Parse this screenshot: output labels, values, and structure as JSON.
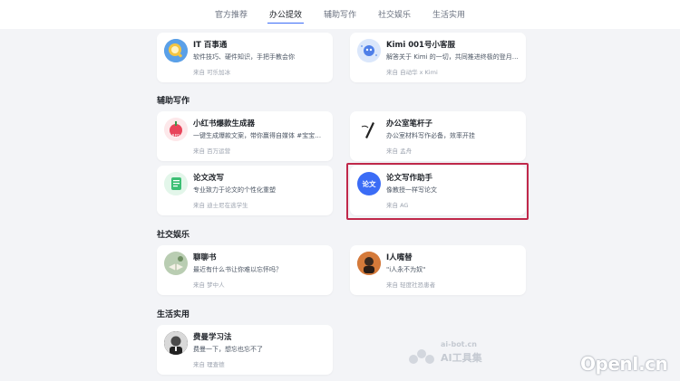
{
  "tabs": [
    "官方推荐",
    "办公提效",
    "辅助写作",
    "社交娱乐",
    "生活实用"
  ],
  "active_tab": "办公提效",
  "sections": {
    "writing": "辅助写作",
    "social": "社交娱乐",
    "life": "生活实用"
  },
  "cards": {
    "it": {
      "title": "IT 百事通",
      "desc": "软件技巧、硬件知识，手把手教会你",
      "author": "来自 可乐加冰"
    },
    "kimi": {
      "title": "Kimi 001号小客服",
      "desc": "解答关于 Kimi 的一切，共同推进终极的登月计划",
      "author": "来自 自动华 x Kimi"
    },
    "xhs": {
      "title": "小红书爆款生成器",
      "desc": "一键生成爆款文案，带你赢得自媒体 #宝宝…",
      "author": "来自 百万运营"
    },
    "pen": {
      "title": "办公室笔杆子",
      "desc": "办公室材料写作必备，效率开挂",
      "author": "来自 孟舟"
    },
    "rewrite": {
      "title": "论文改写",
      "desc": "专业致力于论文的个性化重塑",
      "author": "来自 迪士尼在逃学生"
    },
    "thesis": {
      "title": "论文写作助手",
      "desc": "像教授一样写论文",
      "author": "来自 AG",
      "icon_text": "论文"
    },
    "chat": {
      "title": "聊聊书",
      "desc": "最近有什么书让你难以忘怀吗？",
      "author": "来自 梦中人"
    },
    "irony": {
      "title": "I人嘴替",
      "desc": "\"i人永不为奴\"",
      "author": "来自 轻度社恐患者"
    },
    "feynman": {
      "title": "费曼学习法",
      "desc": "费曼一下，想忘也忘不了",
      "author": "来自 理查德"
    }
  },
  "watermarks": {
    "site_small": "ai-bot.cn",
    "site_large": "AI工具集",
    "brand": "OpenI.cn"
  },
  "colors": {
    "accent": "#3b6cf6",
    "highlight_border": "#c0284a"
  }
}
